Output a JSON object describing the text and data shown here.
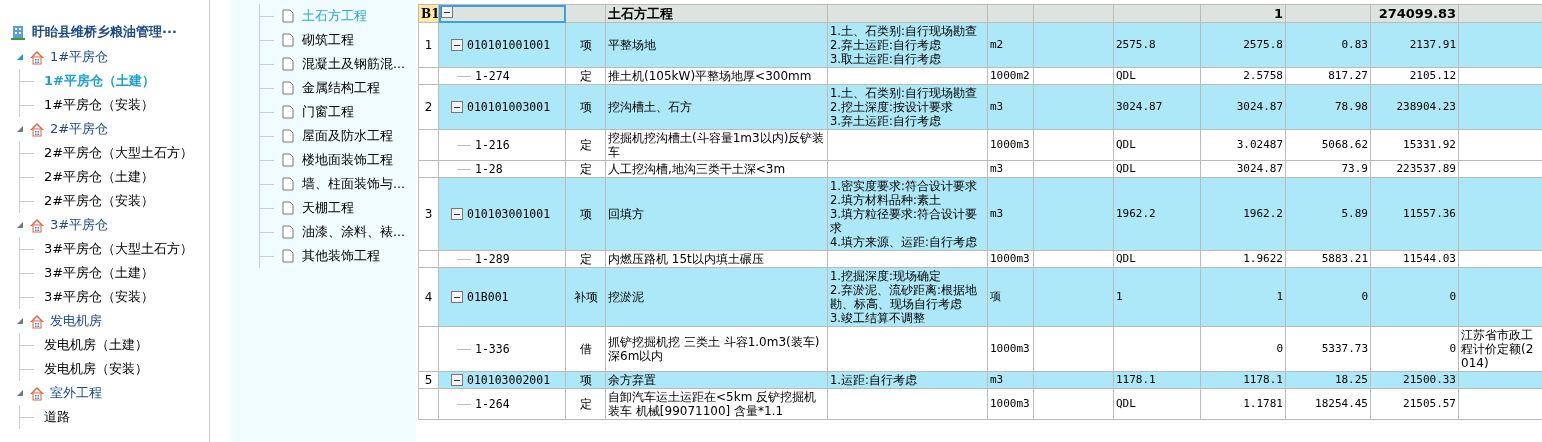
{
  "project_tree": {
    "root": "盱眙县维桥乡粮油管理···",
    "groups": [
      {
        "label": "1#平房仓",
        "expanded": true,
        "children": [
          {
            "label": "1#平房仓（土建）",
            "selected": true
          },
          {
            "label": "1#平房仓（安装）",
            "selected": false
          }
        ]
      },
      {
        "label": "2#平房仓",
        "expanded": true,
        "children": [
          {
            "label": "2#平房仓（大型土石方）",
            "selected": false
          },
          {
            "label": "2#平房仓（土建）",
            "selected": false
          },
          {
            "label": "2#平房仓（安装）",
            "selected": false
          }
        ]
      },
      {
        "label": "3#平房仓",
        "expanded": true,
        "children": [
          {
            "label": "3#平房仓（大型土石方）",
            "selected": false
          },
          {
            "label": "3#平房仓（土建）",
            "selected": false
          },
          {
            "label": "3#平房仓（安装）",
            "selected": false
          }
        ]
      },
      {
        "label": "发电机房",
        "expanded": true,
        "children": [
          {
            "label": "发电机房（土建）",
            "selected": false
          },
          {
            "label": "发电机房（安装）",
            "selected": false
          }
        ]
      },
      {
        "label": "室外工程",
        "expanded": true,
        "children": [
          {
            "label": "道路",
            "selected": false
          }
        ]
      }
    ]
  },
  "sections": [
    {
      "label": "土石方工程",
      "selected": true
    },
    {
      "label": "砌筑工程",
      "selected": false
    },
    {
      "label": "混凝土及钢筋混...",
      "selected": false
    },
    {
      "label": "金属结构工程",
      "selected": false
    },
    {
      "label": "门窗工程",
      "selected": false
    },
    {
      "label": "屋面及防水工程",
      "selected": false
    },
    {
      "label": "楼地面装饰工程",
      "selected": false
    },
    {
      "label": "墙、柱面装饰与...",
      "selected": false
    },
    {
      "label": "天棚工程",
      "selected": false
    },
    {
      "label": "油漆、涂料、裱...",
      "selected": false
    },
    {
      "label": "其他装饰工程",
      "selected": false
    }
  ],
  "table": {
    "section_row": {
      "row_id": "B1",
      "name": "土石方工程",
      "quantity": "1",
      "total": "274099.83"
    },
    "rows": [
      {
        "kind": "item",
        "no": "1",
        "code": "010101001001",
        "type": "项",
        "name": "平整场地",
        "features": "1.土、石类别:自行现场勘查\n2.弃土运距:自行考虑\n3.取土运距:自行考虑",
        "unit": "m2",
        "quantity_expression": "2575.8",
        "quantity": "2575.8",
        "price": "0.83",
        "total": "2137.91"
      },
      {
        "kind": "quota",
        "code": "1-274",
        "type": "定",
        "name": "推土机(105kW)平整场地厚<300mm",
        "unit": "1000m2",
        "quantity_expression": "QDL",
        "quantity": "2.5758",
        "price": "817.27",
        "total": "2105.12"
      },
      {
        "kind": "item",
        "no": "2",
        "code": "010101003001",
        "type": "项",
        "name": "挖沟槽土、石方",
        "features": "1.土、石类别:自行现场勘查\n2.挖土深度:按设计要求\n3.弃土运距:自行考虑",
        "unit": "m3",
        "quantity_expression": "3024.87",
        "quantity": "3024.87",
        "price": "78.98",
        "total": "238904.23"
      },
      {
        "kind": "quota",
        "code": "1-216",
        "type": "定",
        "name": "挖掘机挖沟槽土(斗容量1m3以内)反铲装车",
        "unit": "1000m3",
        "quantity_expression": "QDL",
        "quantity": "3.02487",
        "price": "5068.62",
        "total": "15331.92"
      },
      {
        "kind": "quota",
        "code": "1-28",
        "type": "定",
        "name": "人工挖沟槽,地沟三类干土深<3m",
        "unit": "m3",
        "quantity_expression": "QDL",
        "quantity": "3024.87",
        "price": "73.9",
        "total": "223537.89"
      },
      {
        "kind": "item",
        "no": "3",
        "code": "010103001001",
        "type": "项",
        "name": "回填方",
        "features": "1.密实度要求:符合设计要求\n2.填方材料品种:素土\n3.填方粒径要求:符合设计要求\n4.填方来源、运距:自行考虑",
        "unit": "m3",
        "quantity_expression": "1962.2",
        "quantity": "1962.2",
        "price": "5.89",
        "total": "11557.36"
      },
      {
        "kind": "quota",
        "code": "1-289",
        "type": "定",
        "name": "内燃压路机 15t以内填土碾压",
        "unit": "1000m3",
        "quantity_expression": "QDL",
        "quantity": "1.9622",
        "price": "5883.21",
        "total": "11544.03"
      },
      {
        "kind": "item",
        "no": "4",
        "code": "01B001",
        "type": "补项",
        "name": "挖淤泥",
        "features": "1.挖掘深度:现场确定\n2.弃淤泥、流砂距离:根据地勘、标高、现场自行考虑\n3.竣工结算不调整",
        "unit": "项",
        "quantity_expression": "1",
        "quantity": "1",
        "price": "0",
        "total": "0"
      },
      {
        "kind": "quota",
        "code": "1-336",
        "type": "借",
        "name": "抓铲挖掘机挖 三类土 斗容1.0m3(装车)深6m以内",
        "unit": "1000m3",
        "quantity": "0",
        "price": "5337.73",
        "total": "0",
        "remark": "江苏省市政工程计价定额(2014)"
      },
      {
        "kind": "item",
        "no": "5",
        "code": "010103002001",
        "type": "项",
        "name": "余方弃置",
        "features": "1.运距:自行考虑",
        "unit": "m3",
        "quantity_expression": "1178.1",
        "quantity": "1178.1",
        "price": "18.25",
        "total": "21500.33"
      },
      {
        "kind": "quota",
        "code": "1-264",
        "type": "定",
        "name": "自卸汽车运土运距在<5km  反铲挖掘机装车 机械[99071100] 含量*1.1",
        "unit": "1000m3",
        "quantity_expression": "QDL",
        "quantity": "1.1781",
        "price": "18254.45",
        "total": "21505.57"
      }
    ]
  }
}
